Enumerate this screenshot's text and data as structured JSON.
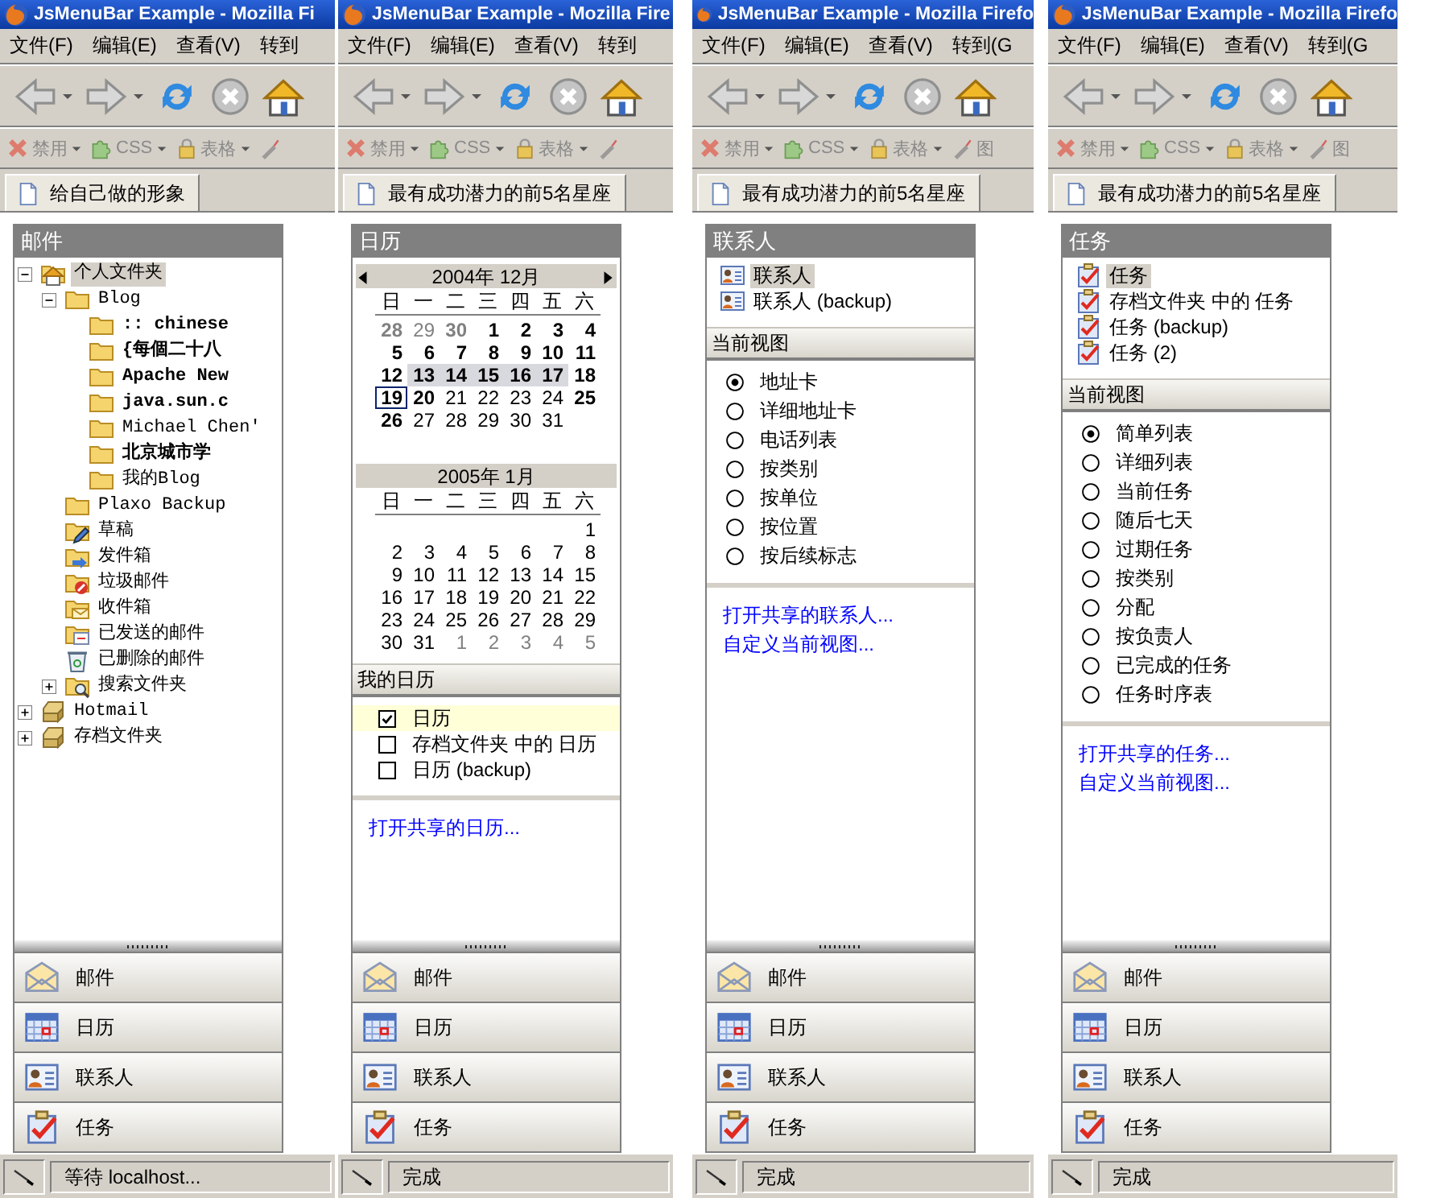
{
  "windows": [
    {
      "title": "JsMenuBar Example - Mozilla Fi",
      "menu": [
        "文件(F)",
        "编辑(E)",
        "查看(V)",
        "转到"
      ],
      "nav_buttons": [
        {
          "kind": "back",
          "disabled": true
        },
        {
          "kind": "forward",
          "disabled": true
        },
        {
          "kind": "reload",
          "disabled": false
        },
        {
          "kind": "stop",
          "disabled": true
        },
        {
          "kind": "house",
          "disabled": false
        }
      ],
      "dev_toolbar": [
        {
          "kind": "x",
          "label": "禁用",
          "has_menu": true,
          "disabled": true
        },
        {
          "kind": "puzzle",
          "label": "CSS",
          "has_menu": true,
          "disabled": true
        },
        {
          "kind": "lock",
          "label": "表格",
          "has_menu": true,
          "disabled": true
        },
        {
          "kind": "wand",
          "has_menu": false,
          "disabled": true
        }
      ],
      "tab": "给自己做的形象",
      "panel": {
        "kind": "mail",
        "heading": "邮件",
        "tree": [
          {
            "label": "个人文件夹",
            "kind": "home",
            "expanded": true,
            "selected": true,
            "unread": false,
            "children": [
              {
                "label": "Blog",
                "kind": "folder",
                "expanded": true,
                "selected": false,
                "unread": false,
                "children": [
                  {
                    "label": ":: chinese",
                    "kind": "folder",
                    "selected": false,
                    "unread": true
                  },
                  {
                    "label": "{每個二十八",
                    "kind": "folder",
                    "selected": false,
                    "unread": true
                  },
                  {
                    "label": "Apache New",
                    "kind": "folder",
                    "selected": false,
                    "unread": true
                  },
                  {
                    "label": "java.sun.c",
                    "kind": "folder",
                    "selected": false,
                    "unread": true
                  },
                  {
                    "label": "Michael Chen'",
                    "kind": "folder",
                    "selected": false,
                    "unread": false
                  },
                  {
                    "label": "北京城市学",
                    "kind": "folder",
                    "selected": false,
                    "unread": true
                  },
                  {
                    "label": "我的Blog",
                    "kind": "folder",
                    "selected": false,
                    "unread": false
                  }
                ]
              },
              {
                "label": "Plaxo Backup",
                "kind": "folder",
                "selected": false,
                "unread": false
              },
              {
                "label": "草稿",
                "kind": "drafts",
                "selected": false,
                "unread": false
              },
              {
                "label": "发件箱",
                "kind": "outbox",
                "selected": false,
                "unread": false
              },
              {
                "label": "垃圾邮件",
                "kind": "junk",
                "selected": false,
                "unread": false
              },
              {
                "label": "收件箱",
                "kind": "inbox",
                "selected": false,
                "unread": false
              },
              {
                "label": "已发送的邮件",
                "kind": "sent",
                "selected": false,
                "unread": false
              },
              {
                "label": "已删除的邮件",
                "kind": "deleted",
                "selected": false,
                "unread": false
              },
              {
                "label": "搜索文件夹",
                "kind": "search",
                "expanded": false,
                "selected": false,
                "unread": false
              }
            ]
          },
          {
            "label": "Hotmail",
            "kind": "store",
            "expanded": false,
            "selected": false,
            "unread": false
          },
          {
            "label": "存档文件夹",
            "kind": "store",
            "expanded": false,
            "selected": false,
            "unread": false
          }
        ]
      },
      "switcher": [
        {
          "label": "邮件",
          "kind": "mail"
        },
        {
          "label": "日历",
          "kind": "calendar"
        },
        {
          "label": "联系人",
          "kind": "contacts"
        },
        {
          "label": "任务",
          "kind": "tasks"
        }
      ],
      "status": "等待 localhost..."
    },
    {
      "title": "JsMenuBar Example - Mozilla Fire",
      "menu": [
        "文件(F)",
        "编辑(E)",
        "查看(V)",
        "转到"
      ],
      "nav_buttons": [
        {
          "kind": "back",
          "disabled": true
        },
        {
          "kind": "forward",
          "disabled": true
        },
        {
          "kind": "reload",
          "disabled": false
        },
        {
          "kind": "stop",
          "disabled": true
        },
        {
          "kind": "house",
          "disabled": false
        }
      ],
      "dev_toolbar": [
        {
          "kind": "x",
          "label": "禁用",
          "has_menu": true,
          "disabled": true
        },
        {
          "kind": "puzzle",
          "label": "CSS",
          "has_menu": true,
          "disabled": true
        },
        {
          "kind": "lock",
          "label": "表格",
          "has_menu": true,
          "disabled": true
        },
        {
          "kind": "wand",
          "has_menu": false,
          "disabled": true
        }
      ],
      "tab": "最有成功潜力的前5名星座",
      "panel": {
        "kind": "calendar",
        "heading": "日历",
        "months": [
          {
            "title": "2004年 12月",
            "prev_arrow": true,
            "next_arrow": true,
            "weekdays": [
              "日",
              "一",
              "二",
              "三",
              "四",
              "五",
              "六"
            ],
            "weeks": [
              [
                {
                  "day": "28",
                  "bold": true,
                  "other_month": true,
                  "selected": false,
                  "today": false
                },
                {
                  "day": "29",
                  "bold": false,
                  "other_month": true,
                  "selected": false,
                  "today": false
                },
                {
                  "day": "30",
                  "bold": true,
                  "other_month": true,
                  "selected": false,
                  "today": false
                },
                {
                  "day": "1",
                  "bold": true,
                  "other_month": false,
                  "selected": false,
                  "today": false
                },
                {
                  "day": "2",
                  "bold": true,
                  "other_month": false,
                  "selected": false,
                  "today": false
                },
                {
                  "day": "3",
                  "bold": true,
                  "other_month": false,
                  "selected": false,
                  "today": false
                },
                {
                  "day": "4",
                  "bold": true,
                  "other_month": false,
                  "selected": false,
                  "today": false
                }
              ],
              [
                {
                  "day": "5",
                  "bold": true,
                  "other_month": false,
                  "selected": false,
                  "today": false
                },
                {
                  "day": "6",
                  "bold": true,
                  "other_month": false,
                  "selected": false,
                  "today": false
                },
                {
                  "day": "7",
                  "bold": true,
                  "other_month": false,
                  "selected": false,
                  "today": false
                },
                {
                  "day": "8",
                  "bold": true,
                  "other_month": false,
                  "selected": false,
                  "today": false
                },
                {
                  "day": "9",
                  "bold": true,
                  "other_month": false,
                  "selected": false,
                  "today": false
                },
                {
                  "day": "10",
                  "bold": true,
                  "other_month": false,
                  "selected": false,
                  "today": false
                },
                {
                  "day": "11",
                  "bold": true,
                  "other_month": false,
                  "selected": false,
                  "today": false
                }
              ],
              [
                {
                  "day": "12",
                  "bold": true,
                  "other_month": false,
                  "selected": false,
                  "today": false
                },
                {
                  "day": "13",
                  "bold": true,
                  "other_month": false,
                  "selected": true,
                  "today": false
                },
                {
                  "day": "14",
                  "bold": true,
                  "other_month": false,
                  "selected": true,
                  "today": false
                },
                {
                  "day": "15",
                  "bold": true,
                  "other_month": false,
                  "selected": true,
                  "today": false
                },
                {
                  "day": "16",
                  "bold": true,
                  "other_month": false,
                  "selected": true,
                  "today": false
                },
                {
                  "day": "17",
                  "bold": true,
                  "other_month": false,
                  "selected": true,
                  "today": false
                },
                {
                  "day": "18",
                  "bold": true,
                  "other_month": false,
                  "selected": false,
                  "today": false
                }
              ],
              [
                {
                  "day": "19",
                  "bold": true,
                  "other_month": false,
                  "selected": false,
                  "today": true
                },
                {
                  "day": "20",
                  "bold": true,
                  "other_month": false,
                  "selected": false,
                  "today": false
                },
                {
                  "day": "21",
                  "bold": false,
                  "other_month": false,
                  "selected": false,
                  "today": false
                },
                {
                  "day": "22",
                  "bold": false,
                  "other_month": false,
                  "selected": false,
                  "today": false
                },
                {
                  "day": "23",
                  "bold": false,
                  "other_month": false,
                  "selected": false,
                  "today": false
                },
                {
                  "day": "24",
                  "bold": false,
                  "other_month": false,
                  "selected": false,
                  "today": false
                },
                {
                  "day": "25",
                  "bold": true,
                  "other_month": false,
                  "selected": false,
                  "today": false
                }
              ],
              [
                {
                  "day": "26",
                  "bold": true,
                  "other_month": false,
                  "selected": false,
                  "today": false
                },
                {
                  "day": "27",
                  "bold": false,
                  "other_month": false,
                  "selected": false,
                  "today": false
                },
                {
                  "day": "28",
                  "bold": false,
                  "other_month": false,
                  "selected": false,
                  "today": false
                },
                {
                  "day": "29",
                  "bold": false,
                  "other_month": false,
                  "selected": false,
                  "today": false
                },
                {
                  "day": "30",
                  "bold": false,
                  "other_month": false,
                  "selected": false,
                  "today": false
                },
                {
                  "day": "31",
                  "bold": false,
                  "other_month": false,
                  "selected": false,
                  "today": false
                }
              ]
            ]
          },
          {
            "title": "2005年 1月",
            "prev_arrow": false,
            "next_arrow": false,
            "weekdays": [
              "日",
              "一",
              "二",
              "三",
              "四",
              "五",
              "六"
            ],
            "weeks": [
              [
                {
                  "day": "1",
                  "bold": false,
                  "other_month": false,
                  "selected": false,
                  "today": false
                }
              ],
              [
                {
                  "day": "2",
                  "bold": false,
                  "other_month": false,
                  "selected": false,
                  "today": false
                },
                {
                  "day": "3",
                  "bold": false,
                  "other_month": false,
                  "selected": false,
                  "today": false
                },
                {
                  "day": "4",
                  "bold": false,
                  "other_month": false,
                  "selected": false,
                  "today": false
                },
                {
                  "day": "5",
                  "bold": false,
                  "other_month": false,
                  "selected": false,
                  "today": false
                },
                {
                  "day": "6",
                  "bold": false,
                  "other_month": false,
                  "selected": false,
                  "today": false
                },
                {
                  "day": "7",
                  "bold": false,
                  "other_month": false,
                  "selected": false,
                  "today": false
                },
                {
                  "day": "8",
                  "bold": false,
                  "other_month": false,
                  "selected": false,
                  "today": false
                }
              ],
              [
                {
                  "day": "9",
                  "bold": false,
                  "other_month": false,
                  "selected": false,
                  "today": false
                },
                {
                  "day": "10",
                  "bold": false,
                  "other_month": false,
                  "selected": false,
                  "today": false
                },
                {
                  "day": "11",
                  "bold": false,
                  "other_month": false,
                  "selected": false,
                  "today": false
                },
                {
                  "day": "12",
                  "bold": false,
                  "other_month": false,
                  "selected": false,
                  "today": false
                },
                {
                  "day": "13",
                  "bold": false,
                  "other_month": false,
                  "selected": false,
                  "today": false
                },
                {
                  "day": "14",
                  "bold": false,
                  "other_month": false,
                  "selected": false,
                  "today": false
                },
                {
                  "day": "15",
                  "bold": false,
                  "other_month": false,
                  "selected": false,
                  "today": false
                }
              ],
              [
                {
                  "day": "16",
                  "bold": false,
                  "other_month": false,
                  "selected": false,
                  "today": false
                },
                {
                  "day": "17",
                  "bold": false,
                  "other_month": false,
                  "selected": false,
                  "today": false
                },
                {
                  "day": "18",
                  "bold": false,
                  "other_month": false,
                  "selected": false,
                  "today": false
                },
                {
                  "day": "19",
                  "bold": false,
                  "other_month": false,
                  "selected": false,
                  "today": false
                },
                {
                  "day": "20",
                  "bold": false,
                  "other_month": false,
                  "selected": false,
                  "today": false
                },
                {
                  "day": "21",
                  "bold": false,
                  "other_month": false,
                  "selected": false,
                  "today": false
                },
                {
                  "day": "22",
                  "bold": false,
                  "other_month": false,
                  "selected": false,
                  "today": false
                }
              ],
              [
                {
                  "day": "23",
                  "bold": false,
                  "other_month": false,
                  "selected": false,
                  "today": false
                },
                {
                  "day": "24",
                  "bold": false,
                  "other_month": false,
                  "selected": false,
                  "today": false
                },
                {
                  "day": "25",
                  "bold": false,
                  "other_month": false,
                  "selected": false,
                  "today": false
                },
                {
                  "day": "26",
                  "bold": false,
                  "other_month": false,
                  "selected": false,
                  "today": false
                },
                {
                  "day": "27",
                  "bold": false,
                  "other_month": false,
                  "selected": false,
                  "today": false
                },
                {
                  "day": "28",
                  "bold": false,
                  "other_month": false,
                  "selected": false,
                  "today": false
                },
                {
                  "day": "29",
                  "bold": false,
                  "other_month": false,
                  "selected": false,
                  "today": false
                }
              ],
              [
                {
                  "day": "30",
                  "bold": false,
                  "other_month": false,
                  "selected": false,
                  "today": false
                },
                {
                  "day": "31",
                  "bold": false,
                  "other_month": false,
                  "selected": false,
                  "today": false
                },
                {
                  "day": "1",
                  "bold": false,
                  "other_month": true,
                  "selected": false,
                  "today": false
                },
                {
                  "day": "2",
                  "bold": false,
                  "other_month": true,
                  "selected": false,
                  "today": false
                },
                {
                  "day": "3",
                  "bold": false,
                  "other_month": true,
                  "selected": false,
                  "today": false
                },
                {
                  "day": "4",
                  "bold": false,
                  "other_month": true,
                  "selected": false,
                  "today": false
                },
                {
                  "day": "5",
                  "bold": false,
                  "other_month": true,
                  "selected": false,
                  "today": false
                }
              ]
            ]
          }
        ],
        "section": "我的日历",
        "calendars": [
          {
            "label": "日历",
            "checked": true,
            "selected": true
          },
          {
            "label": "存档文件夹 中的 日历",
            "checked": false,
            "selected": false
          },
          {
            "label": "日历 (backup)",
            "checked": false,
            "selected": false
          }
        ],
        "links": [
          "打开共享的日历..."
        ]
      },
      "switcher": [
        {
          "label": "邮件",
          "kind": "mail"
        },
        {
          "label": "日历",
          "kind": "calendar"
        },
        {
          "label": "联系人",
          "kind": "contacts"
        },
        {
          "label": "任务",
          "kind": "tasks"
        }
      ],
      "status": "完成"
    },
    {
      "title": "JsMenuBar Example - Mozilla Firefo",
      "menu": [
        "文件(F)",
        "编辑(E)",
        "查看(V)",
        "转到(G"
      ],
      "nav_buttons": [
        {
          "kind": "back",
          "disabled": true
        },
        {
          "kind": "forward",
          "disabled": true
        },
        {
          "kind": "reload",
          "disabled": false
        },
        {
          "kind": "stop",
          "disabled": true
        },
        {
          "kind": "house",
          "disabled": false
        }
      ],
      "dev_toolbar": [
        {
          "kind": "x",
          "label": "禁用",
          "has_menu": true,
          "disabled": true
        },
        {
          "kind": "puzzle",
          "label": "CSS",
          "has_menu": true,
          "disabled": true
        },
        {
          "kind": "lock",
          "label": "表格",
          "has_menu": true,
          "disabled": true
        },
        {
          "kind": "wand",
          "label": "图",
          "has_menu": false,
          "disabled": true
        }
      ],
      "tab": "最有成功潜力的前5名星座",
      "panel": {
        "kind": "contacts",
        "heading": "联系人",
        "folders": [
          {
            "label": "联系人",
            "selected": true
          },
          {
            "label": "联系人 (backup)",
            "selected": false
          }
        ],
        "section": "当前视图",
        "views": [
          {
            "label": "地址卡",
            "selected": true
          },
          {
            "label": "详细地址卡",
            "selected": false
          },
          {
            "label": "电话列表",
            "selected": false
          },
          {
            "label": "按类别",
            "selected": false
          },
          {
            "label": "按单位",
            "selected": false
          },
          {
            "label": "按位置",
            "selected": false
          },
          {
            "label": "按后续标志",
            "selected": false
          }
        ],
        "links": [
          "打开共享的联系人...",
          "自定义当前视图..."
        ]
      },
      "switcher": [
        {
          "label": "邮件",
          "kind": "mail"
        },
        {
          "label": "日历",
          "kind": "calendar"
        },
        {
          "label": "联系人",
          "kind": "contacts"
        },
        {
          "label": "任务",
          "kind": "tasks"
        }
      ],
      "status": "完成"
    },
    {
      "title": "JsMenuBar Example - Mozilla Firefo",
      "menu": [
        "文件(F)",
        "编辑(E)",
        "查看(V)",
        "转到(G"
      ],
      "nav_buttons": [
        {
          "kind": "back",
          "disabled": true
        },
        {
          "kind": "forward",
          "disabled": true
        },
        {
          "kind": "reload",
          "disabled": false
        },
        {
          "kind": "stop",
          "disabled": true
        },
        {
          "kind": "house",
          "disabled": false
        }
      ],
      "dev_toolbar": [
        {
          "kind": "x",
          "label": "禁用",
          "has_menu": true,
          "disabled": true
        },
        {
          "kind": "puzzle",
          "label": "CSS",
          "has_menu": true,
          "disabled": true
        },
        {
          "kind": "lock",
          "label": "表格",
          "has_menu": true,
          "disabled": true
        },
        {
          "kind": "wand",
          "label": "图",
          "has_menu": false,
          "disabled": true
        }
      ],
      "tab": "最有成功潜力的前5名星座",
      "panel": {
        "kind": "tasks",
        "heading": "任务",
        "folders": [
          {
            "label": "任务",
            "selected": true
          },
          {
            "label": "存档文件夹 中的 任务",
            "selected": false
          },
          {
            "label": "任务 (backup)",
            "selected": false
          },
          {
            "label": "任务 (2)",
            "selected": false
          }
        ],
        "section": "当前视图",
        "views": [
          {
            "label": "简单列表",
            "selected": true
          },
          {
            "label": "详细列表",
            "selected": false
          },
          {
            "label": "当前任务",
            "selected": false
          },
          {
            "label": "随后七天",
            "selected": false
          },
          {
            "label": "过期任务",
            "selected": false
          },
          {
            "label": "按类别",
            "selected": false
          },
          {
            "label": "分配",
            "selected": false
          },
          {
            "label": "按负责人",
            "selected": false
          },
          {
            "label": "已完成的任务",
            "selected": false
          },
          {
            "label": "任务时序表",
            "selected": false
          }
        ],
        "links": [
          "打开共享的任务...",
          "自定义当前视图..."
        ]
      },
      "switcher": [
        {
          "label": "邮件",
          "kind": "mail"
        },
        {
          "label": "日历",
          "kind": "calendar"
        },
        {
          "label": "联系人",
          "kind": "contacts"
        },
        {
          "label": "任务",
          "kind": "tasks"
        }
      ],
      "status": "完成"
    }
  ]
}
